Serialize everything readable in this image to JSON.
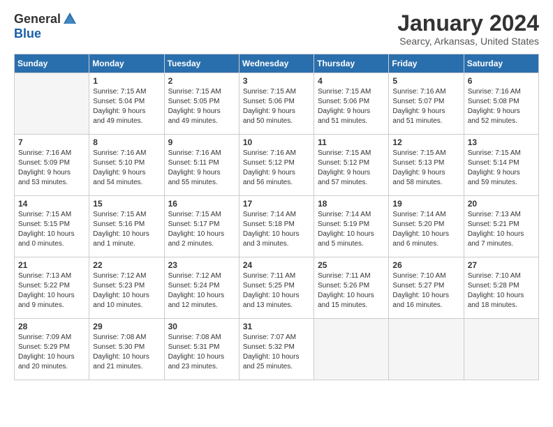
{
  "logo": {
    "general": "General",
    "blue": "Blue"
  },
  "title": "January 2024",
  "location": "Searcy, Arkansas, United States",
  "days_of_week": [
    "Sunday",
    "Monday",
    "Tuesday",
    "Wednesday",
    "Thursday",
    "Friday",
    "Saturday"
  ],
  "weeks": [
    [
      {
        "day": "",
        "info": ""
      },
      {
        "day": "1",
        "info": "Sunrise: 7:15 AM\nSunset: 5:04 PM\nDaylight: 9 hours\nand 49 minutes."
      },
      {
        "day": "2",
        "info": "Sunrise: 7:15 AM\nSunset: 5:05 PM\nDaylight: 9 hours\nand 49 minutes."
      },
      {
        "day": "3",
        "info": "Sunrise: 7:15 AM\nSunset: 5:06 PM\nDaylight: 9 hours\nand 50 minutes."
      },
      {
        "day": "4",
        "info": "Sunrise: 7:15 AM\nSunset: 5:06 PM\nDaylight: 9 hours\nand 51 minutes."
      },
      {
        "day": "5",
        "info": "Sunrise: 7:16 AM\nSunset: 5:07 PM\nDaylight: 9 hours\nand 51 minutes."
      },
      {
        "day": "6",
        "info": "Sunrise: 7:16 AM\nSunset: 5:08 PM\nDaylight: 9 hours\nand 52 minutes."
      }
    ],
    [
      {
        "day": "7",
        "info": "Sunrise: 7:16 AM\nSunset: 5:09 PM\nDaylight: 9 hours\nand 53 minutes."
      },
      {
        "day": "8",
        "info": "Sunrise: 7:16 AM\nSunset: 5:10 PM\nDaylight: 9 hours\nand 54 minutes."
      },
      {
        "day": "9",
        "info": "Sunrise: 7:16 AM\nSunset: 5:11 PM\nDaylight: 9 hours\nand 55 minutes."
      },
      {
        "day": "10",
        "info": "Sunrise: 7:16 AM\nSunset: 5:12 PM\nDaylight: 9 hours\nand 56 minutes."
      },
      {
        "day": "11",
        "info": "Sunrise: 7:15 AM\nSunset: 5:12 PM\nDaylight: 9 hours\nand 57 minutes."
      },
      {
        "day": "12",
        "info": "Sunrise: 7:15 AM\nSunset: 5:13 PM\nDaylight: 9 hours\nand 58 minutes."
      },
      {
        "day": "13",
        "info": "Sunrise: 7:15 AM\nSunset: 5:14 PM\nDaylight: 9 hours\nand 59 minutes."
      }
    ],
    [
      {
        "day": "14",
        "info": "Sunrise: 7:15 AM\nSunset: 5:15 PM\nDaylight: 10 hours\nand 0 minutes."
      },
      {
        "day": "15",
        "info": "Sunrise: 7:15 AM\nSunset: 5:16 PM\nDaylight: 10 hours\nand 1 minute."
      },
      {
        "day": "16",
        "info": "Sunrise: 7:15 AM\nSunset: 5:17 PM\nDaylight: 10 hours\nand 2 minutes."
      },
      {
        "day": "17",
        "info": "Sunrise: 7:14 AM\nSunset: 5:18 PM\nDaylight: 10 hours\nand 3 minutes."
      },
      {
        "day": "18",
        "info": "Sunrise: 7:14 AM\nSunset: 5:19 PM\nDaylight: 10 hours\nand 5 minutes."
      },
      {
        "day": "19",
        "info": "Sunrise: 7:14 AM\nSunset: 5:20 PM\nDaylight: 10 hours\nand 6 minutes."
      },
      {
        "day": "20",
        "info": "Sunrise: 7:13 AM\nSunset: 5:21 PM\nDaylight: 10 hours\nand 7 minutes."
      }
    ],
    [
      {
        "day": "21",
        "info": "Sunrise: 7:13 AM\nSunset: 5:22 PM\nDaylight: 10 hours\nand 9 minutes."
      },
      {
        "day": "22",
        "info": "Sunrise: 7:12 AM\nSunset: 5:23 PM\nDaylight: 10 hours\nand 10 minutes."
      },
      {
        "day": "23",
        "info": "Sunrise: 7:12 AM\nSunset: 5:24 PM\nDaylight: 10 hours\nand 12 minutes."
      },
      {
        "day": "24",
        "info": "Sunrise: 7:11 AM\nSunset: 5:25 PM\nDaylight: 10 hours\nand 13 minutes."
      },
      {
        "day": "25",
        "info": "Sunrise: 7:11 AM\nSunset: 5:26 PM\nDaylight: 10 hours\nand 15 minutes."
      },
      {
        "day": "26",
        "info": "Sunrise: 7:10 AM\nSunset: 5:27 PM\nDaylight: 10 hours\nand 16 minutes."
      },
      {
        "day": "27",
        "info": "Sunrise: 7:10 AM\nSunset: 5:28 PM\nDaylight: 10 hours\nand 18 minutes."
      }
    ],
    [
      {
        "day": "28",
        "info": "Sunrise: 7:09 AM\nSunset: 5:29 PM\nDaylight: 10 hours\nand 20 minutes."
      },
      {
        "day": "29",
        "info": "Sunrise: 7:08 AM\nSunset: 5:30 PM\nDaylight: 10 hours\nand 21 minutes."
      },
      {
        "day": "30",
        "info": "Sunrise: 7:08 AM\nSunset: 5:31 PM\nDaylight: 10 hours\nand 23 minutes."
      },
      {
        "day": "31",
        "info": "Sunrise: 7:07 AM\nSunset: 5:32 PM\nDaylight: 10 hours\nand 25 minutes."
      },
      {
        "day": "",
        "info": ""
      },
      {
        "day": "",
        "info": ""
      },
      {
        "day": "",
        "info": ""
      }
    ]
  ]
}
